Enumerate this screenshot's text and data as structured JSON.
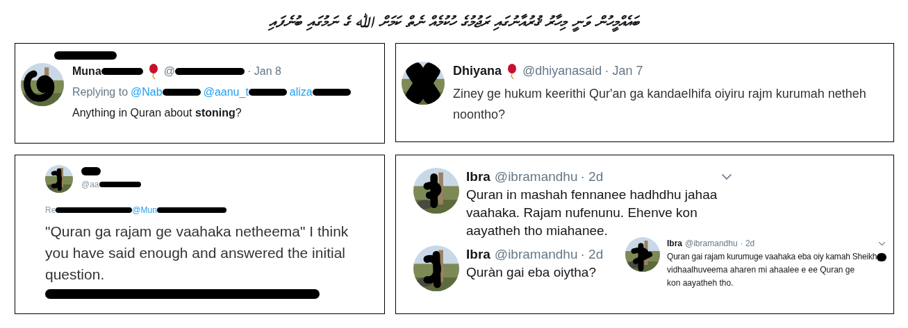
{
  "title": "ބައެއްމީހުން ވަނީ މިހާރު ޤުރުއާނުގައި ރަޖުމުގެ ހުކުމެއް ނެތް ކަމަށް ﷲ ގެ ނަމުގައި ބުނެފައި",
  "panel_top_left": {
    "name": "Muna",
    "balloon": true,
    "handle": "@",
    "time": "· Jan 8",
    "replying_to": "Replying to",
    "mentions": [
      "@Nab",
      "@aanu_t",
      "aliza"
    ],
    "text": "Anything in Quran about **stoning**?"
  },
  "panel_top_right": {
    "name": "Dhiyana",
    "balloon": true,
    "handle": "@dhiyanasaid",
    "time": "· Jan 7",
    "text": "Ziney ge hukum keerithi Qur'an ga kandaelhifa oiyiru rajm kurumah netheh noontho?"
  },
  "panel_bottom_left": {
    "handle": "@aa",
    "replying_to": "Re",
    "mentions": [
      "@Mun"
    ],
    "text": "\"Quran ga rajam ge vaahaka netheema\" I think you have said enough and answered the initial question."
  },
  "panel_bottom_right": {
    "tweets": [
      {
        "name": "Ibra",
        "handle": "@ibramandhu",
        "time": "· 2d",
        "menu": true,
        "text": "Quran in mashah fennanee hadhdhu jahaa vaahaka. Rajam nufenunu. Ehenve kon aayatheh tho miahanee."
      },
      {
        "name": "Ibra",
        "handle": "@ibramandhu",
        "time": "· 2d",
        "menu": false,
        "text": "Quràn gai eba oiytha?"
      }
    ],
    "inset": {
      "name": "Ibra",
      "handle": "@ibramandhu",
      "time": "· 2d",
      "menu": true,
      "text_lines": [
        "Quran gai rajam kurumuge vaahaka eba oiy kamah Sheikh",
        "vidhaalhuveema aharen mi ahaalee e ee Quran ge kon aayatheh tho."
      ]
    }
  }
}
